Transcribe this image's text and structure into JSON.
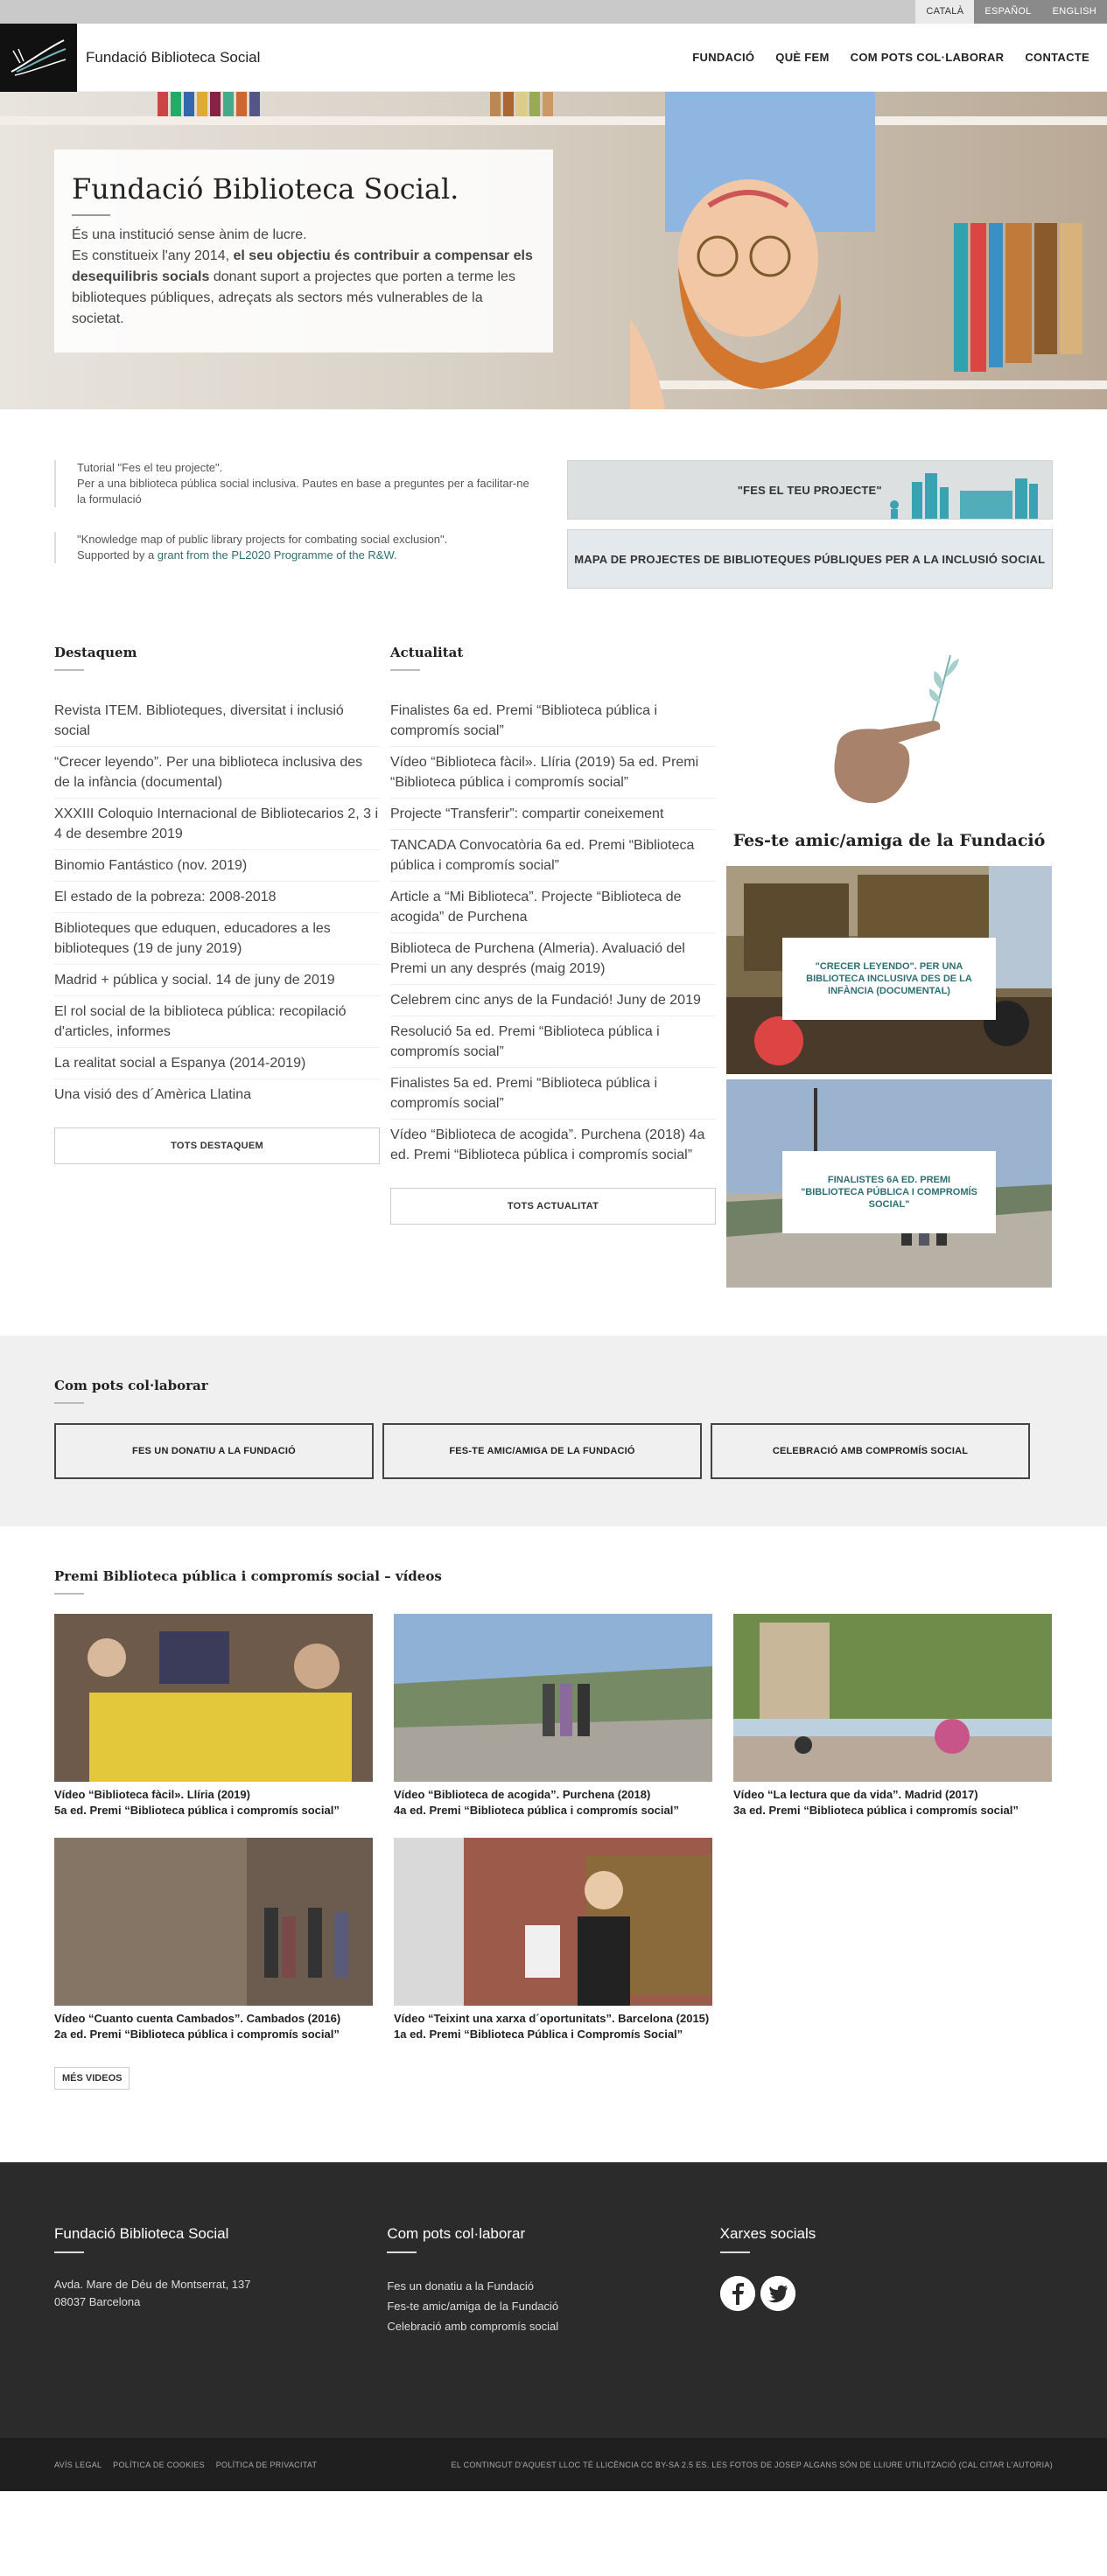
{
  "langbar": {
    "items": [
      {
        "label": "CATALÀ",
        "active": true
      },
      {
        "label": "ESPAÑOL",
        "active": false
      },
      {
        "label": "ENGLISH",
        "active": false
      }
    ]
  },
  "header": {
    "site_name": "Fundació Biblioteca Social",
    "nav": [
      "FUNDACIÓ",
      "QUÈ FEM",
      "COM POTS COL·LABORAR",
      "CONTACTE"
    ]
  },
  "hero": {
    "title": "Fundació Biblioteca Social.",
    "line1": "És una institució sense ànim de lucre.",
    "line2_pre": "Es constitueix l'any 2014, ",
    "line2_bold": "el seu objectiu és contribuir a compensar els desequilibris socials",
    "line2_post": " donant suport a projectes que porten a terme les biblioteques públiques, adreçats als sectors més vulnerables de la societat."
  },
  "projects": {
    "item1": {
      "l1": "Tutorial \"Fes el teu projecte\".",
      "l2": "Per a una biblioteca pública social inclusiva. Pautes en base a preguntes per a facilitar-ne la formulació"
    },
    "item2": {
      "l1": "\"Knowledge map of public library projects for combating social exclusion\".",
      "pre": "Supported by a ",
      "link": "grant from the PL2020 Programme of the R&W."
    },
    "btn1": "\"FES EL TEU PROJECTE\"",
    "btn2": "MAPA DE PROJECTES DE BIBLIOTEQUES PÚBLIQUES PER A LA INCLUSIÓ SOCIAL"
  },
  "destaquem": {
    "title": "Destaquem",
    "items": [
      "Revista ITEM. Biblioteques, diversitat i inclusió social",
      "“Crecer leyendo”. Per una biblioteca inclusiva des de la infància (documental)",
      "XXXIII Coloquio Internacional de Bibliotecarios 2, 3 i 4 de desembre 2019",
      "Binomio Fantástico (nov. 2019)",
      "El estado de la pobreza: 2008-2018",
      "Biblioteques que eduquen, educadores a les biblioteques (19 de juny 2019)",
      "Madrid + pública y social. 14 de juny de 2019",
      "El rol social de la biblioteca pública: recopilació d'articles, informes",
      "La realitat social a Espanya (2014-2019)",
      "Una visió des d´Amèrica Llatina"
    ],
    "button": "TOTS DESTAQUEM"
  },
  "actualitat": {
    "title": "Actualitat",
    "items": [
      "Finalistes 6a ed. Premi “Biblioteca pública i compromís social”",
      "Vídeo “Biblioteca fàcil». Llíria (2019) 5a ed. Premi “Biblioteca pública i compromís social”",
      "Projecte “Transferir”: compartir coneixement",
      "TANCADA Convocatòria 6a ed. Premi “Biblioteca pública i compromís social”",
      "Article a “Mi Biblioteca”. Projecte “Biblioteca de acogida” de Purchena",
      "Biblioteca de Purchena (Almeria). Avaluació del Premi un any després (maig 2019)",
      "Celebrem cinc anys de la Fundació! Juny de 2019",
      "Resolució 5a ed. Premi “Biblioteca pública i compromís social”",
      "Finalistes 5a ed. Premi “Biblioteca pública i compromís social”",
      "Vídeo “Biblioteca de acogida”. Purchena (2018) 4a ed. Premi “Biblioteca pública i compromís social”"
    ],
    "button": "TOTS ACTUALITAT"
  },
  "friend": {
    "title": "Fes-te amic/amiga de la Fundació",
    "card1": "\"CRECER LEYENDO\". PER UNA BIBLIOTECA INCLUSIVA DES DE LA INFÀNCIA (DOCUMENTAL)",
    "card2": "FINALISTES 6A ED. PREMI \"BIBLIOTECA PÚBLICA I COMPROMÍS SOCIAL\""
  },
  "collab": {
    "title": "Com pots col·laborar",
    "buttons": [
      "FES UN DONATIU A LA FUNDACIÓ",
      "FES-TE AMIC/AMIGA DE LA FUNDACIÓ",
      "CELEBRACIÓ AMB COMPROMÍS SOCIAL"
    ]
  },
  "videos": {
    "title": "Premi Biblioteca pública i compromís social – vídeos",
    "items": [
      {
        "l1": "Vídeo “Biblioteca fàcil». Llíria (2019)",
        "l2": "5a ed. Premi “Biblioteca pública i compromís social”"
      },
      {
        "l1": "Vídeo “Biblioteca de acogida”. Purchena (2018)",
        "l2": "4a ed. Premi “Biblioteca pública i compromís social”"
      },
      {
        "l1": "Vídeo “La lectura que da vida”. Madrid (2017)",
        "l2": "3a ed. Premi “Biblioteca pública i compromís social”"
      },
      {
        "l1": "Vídeo “Cuanto cuenta Cambados”. Cambados (2016)",
        "l2": "2a ed. Premi “Biblioteca pública i compromís social”"
      },
      {
        "l1": "Vídeo “Teixint una xarxa d´oportunitats”. Barcelona (2015)",
        "l2": "1a ed. Premi “Biblioteca Pública i Compromís Social”"
      }
    ],
    "more": "MÉS VIDEOS"
  },
  "footer": {
    "col1_title": "Fundació Biblioteca Social",
    "address1": "Avda. Mare de Déu de Montserrat, 137",
    "address2": "08037 Barcelona",
    "col2_title": "Com pots col·laborar",
    "col2_links": [
      "Fes un donatiu a la Fundació",
      "Fes-te amic/amiga de la Fundació",
      "Celebració amb compromís social"
    ],
    "col3_title": "Xarxes socials",
    "social": [
      "facebook-icon",
      "twitter-icon"
    ]
  },
  "bottom": {
    "links": [
      "AVÍS LEGAL",
      "POLÍTICA DE COOKIES",
      "POLÍTICA DE PRIVACITAT"
    ],
    "license": "EL CONTINGUT D'AQUEST LLOC TÉ LLICÈNCIA CC BY-SA 2.5 ES. LES FOTOS DE JOSEP ALGANS SÓN DE LLIURE UTILITZACIÓ (CAL CITAR L'AUTORIA)"
  }
}
